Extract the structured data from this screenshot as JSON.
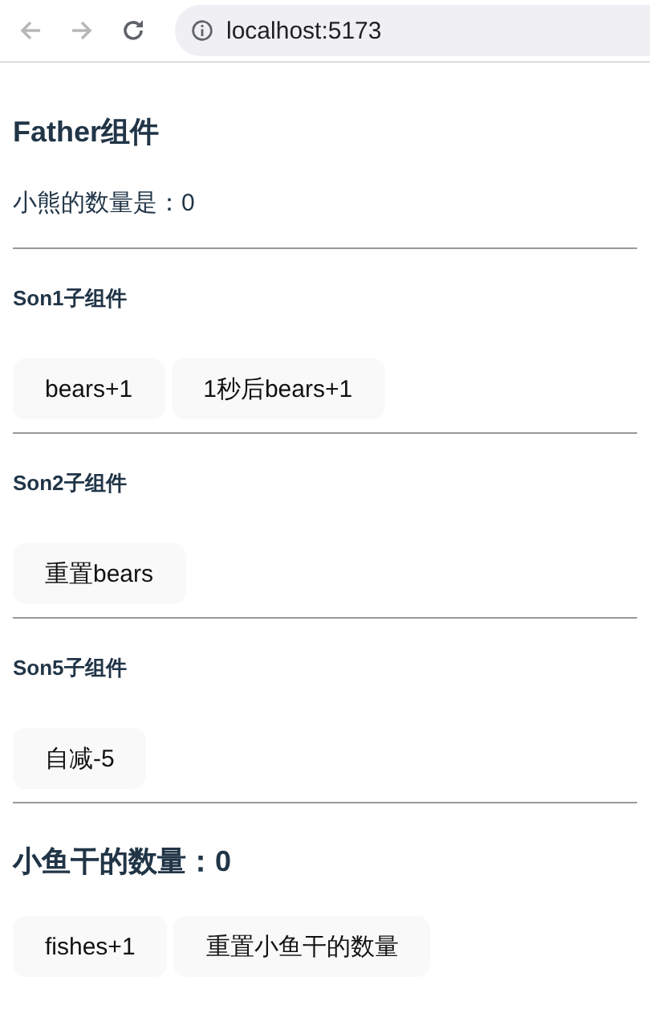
{
  "browser": {
    "back": {
      "disabled": true
    },
    "forward": {
      "disabled": true
    },
    "url": "localhost:5173"
  },
  "father": {
    "title": "Father组件",
    "bears_text": "小熊的数量是：0"
  },
  "children": [
    {
      "title": "Son1子组件",
      "buttons": [
        "bears+1",
        "1秒后bears+1"
      ]
    },
    {
      "title": "Son2子组件",
      "buttons": [
        "重置bears"
      ]
    },
    {
      "title": "Son5子组件",
      "buttons": [
        "自减-5"
      ]
    }
  ],
  "fish": {
    "title": "小鱼干的数量：0",
    "buttons": [
      "fishes+1",
      "重置小鱼干的数量"
    ]
  }
}
